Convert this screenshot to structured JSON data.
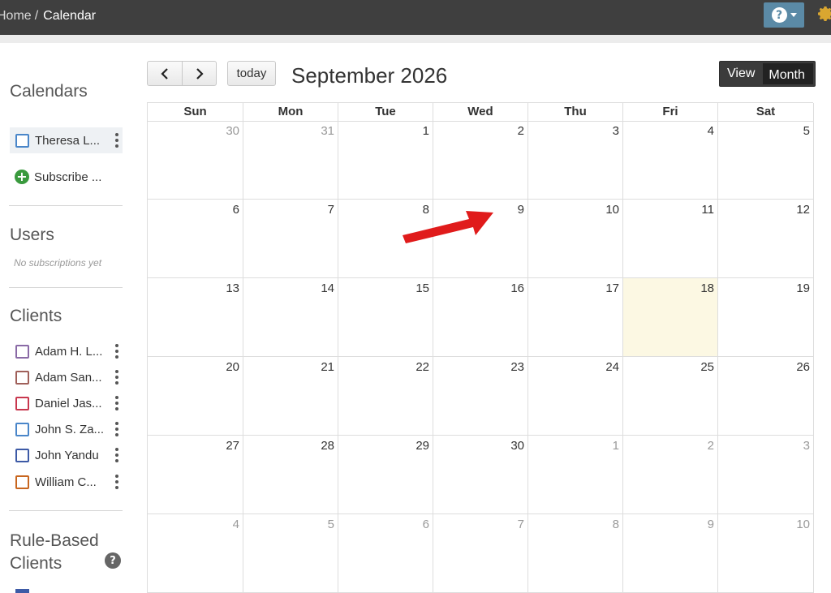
{
  "breadcrumb": {
    "home": "Home",
    "separator": "/",
    "current": "Calendar"
  },
  "header": {
    "help_icon": "?"
  },
  "sidebar": {
    "calendars_heading": "Calendars",
    "calendars": [
      {
        "label": "Theresa L...",
        "color": "#4a86c9"
      }
    ],
    "subscribe_label": "Subscribe ...",
    "users_heading": "Users",
    "users_empty": "No subscriptions yet",
    "clients_heading": "Clients",
    "clients": [
      {
        "label": "Adam H. L...",
        "color": "#8a6aa6"
      },
      {
        "label": "Adam San...",
        "color": "#a0605a"
      },
      {
        "label": "Daniel Jas...",
        "color": "#c8374e"
      },
      {
        "label": "John S. Za...",
        "color": "#4a86c9"
      },
      {
        "label": "John Yandu",
        "color": "#3d5aa6"
      },
      {
        "label": "William C...",
        "color": "#c8661f"
      }
    ],
    "rule_heading_line1": "Rule-Based",
    "rule_heading_line2": "Clients",
    "rule_help_icon": "?"
  },
  "toolbar": {
    "prev_label": "<",
    "next_label": ">",
    "today_label": "today",
    "month_title": "September 2026",
    "view_label": "View",
    "view_value": "Month"
  },
  "calendar": {
    "weekdays": [
      "Sun",
      "Mon",
      "Tue",
      "Wed",
      "Thu",
      "Fri",
      "Sat"
    ],
    "weeks": [
      [
        {
          "day": "30",
          "other": true
        },
        {
          "day": "31",
          "other": true
        },
        {
          "day": "1"
        },
        {
          "day": "2"
        },
        {
          "day": "3"
        },
        {
          "day": "4"
        },
        {
          "day": "5"
        }
      ],
      [
        {
          "day": "6"
        },
        {
          "day": "7"
        },
        {
          "day": "8"
        },
        {
          "day": "9"
        },
        {
          "day": "10"
        },
        {
          "day": "11"
        },
        {
          "day": "12"
        }
      ],
      [
        {
          "day": "13"
        },
        {
          "day": "14"
        },
        {
          "day": "15"
        },
        {
          "day": "16"
        },
        {
          "day": "17"
        },
        {
          "day": "18",
          "today": true
        },
        {
          "day": "19"
        }
      ],
      [
        {
          "day": "20"
        },
        {
          "day": "21"
        },
        {
          "day": "22"
        },
        {
          "day": "23"
        },
        {
          "day": "24"
        },
        {
          "day": "25"
        },
        {
          "day": "26"
        }
      ],
      [
        {
          "day": "27"
        },
        {
          "day": "28"
        },
        {
          "day": "29"
        },
        {
          "day": "30"
        },
        {
          "day": "1",
          "other": true
        },
        {
          "day": "2",
          "other": true
        },
        {
          "day": "3",
          "other": true
        }
      ],
      [
        {
          "day": "4",
          "other": true
        },
        {
          "day": "5",
          "other": true
        },
        {
          "day": "6",
          "other": true
        },
        {
          "day": "7",
          "other": true
        },
        {
          "day": "8",
          "other": true
        },
        {
          "day": "9",
          "other": true
        },
        {
          "day": "10",
          "other": true
        }
      ]
    ]
  },
  "annotation": {
    "arrow_color": "#e01b1b"
  }
}
